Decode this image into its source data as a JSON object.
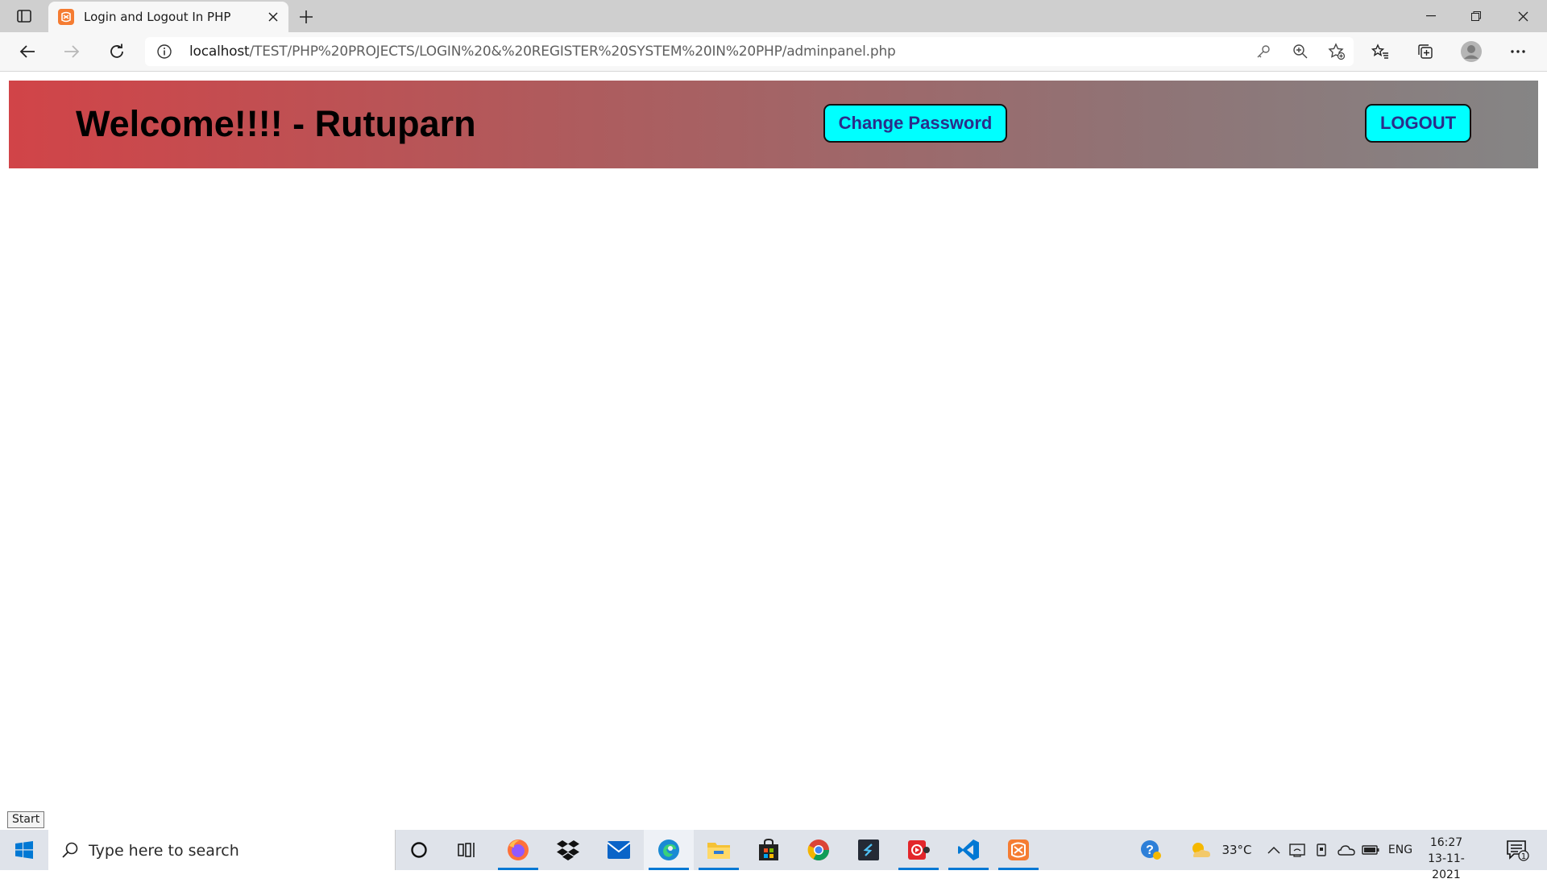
{
  "browser": {
    "tab": {
      "title": "Login and Logout In PHP"
    },
    "address_bar": {
      "host": "localhost",
      "path": "/TEST/PHP%20PROJECTS/LOGIN%20&%20REGISTER%20SYSTEM%20IN%20PHP/adminpanel.php"
    }
  },
  "page": {
    "welcome_text": "Welcome!!!! - Rutuparn",
    "change_password_label": "Change Password",
    "logout_label": "LOGOUT"
  },
  "tooltip": {
    "start": "Start"
  },
  "taskbar": {
    "search_placeholder": "Type here to search",
    "apps": [
      "cortana-icon",
      "task-view-icon",
      "firefox-icon",
      "dropbox-icon",
      "mail-icon",
      "edge-icon",
      "file-explorer-icon",
      "store-icon",
      "chrome-icon",
      "sublime-text-icon",
      "media-player-icon",
      "vscode-icon",
      "xampp-icon"
    ],
    "weather": "33°C",
    "language": "ENG",
    "time": "16:27",
    "date": "13-11-2021",
    "notification_count": "1"
  },
  "colors": {
    "header_start": "#d14448",
    "header_end": "#858585",
    "button_bg": "#00ffff",
    "button_text": "#2b2d8a",
    "taskbar_accent": "#0078d4"
  }
}
